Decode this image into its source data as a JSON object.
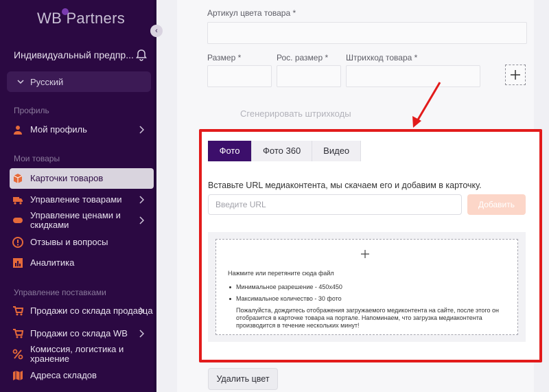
{
  "app": {
    "logo_text": "WB Partners"
  },
  "sidebar": {
    "org_name": "Индивидуальный предпр...",
    "language": "Русский",
    "sections": {
      "profile": "Профиль",
      "goods": "Мои товары",
      "supply": "Управление поставками"
    },
    "items": [
      {
        "label": "Мой профиль",
        "icon": "user-icon"
      },
      {
        "label": "Карточки товаров",
        "icon": "box-icon",
        "active": true
      },
      {
        "label": "Управление товарами",
        "icon": "truck-icon"
      },
      {
        "label": "Управление ценами и скидками",
        "icon": "tag-icon"
      },
      {
        "label": "Отзывы и вопросы",
        "icon": "alert-icon"
      },
      {
        "label": "Аналитика",
        "icon": "chart-icon"
      },
      {
        "label": "Продажи со склада продавца",
        "icon": "cart-icon"
      },
      {
        "label": "Продажи со склада WB",
        "icon": "cart-icon"
      },
      {
        "label": "Комиссия, логистика и хранение",
        "icon": "percent-icon"
      },
      {
        "label": "Адреса складов",
        "icon": "map-icon"
      }
    ]
  },
  "form": {
    "color_article_label": "Артикул цвета товара *",
    "size_label": "Размер *",
    "ru_size_label": "Рос. размер *",
    "barcode_label": "Штрихкод товара *",
    "generate_barcodes": "Сгенерировать штрихкоды",
    "delete_color": "Удалить цвет"
  },
  "media": {
    "tabs": [
      "Фото",
      "Фото 360",
      "Видео"
    ],
    "active_tab": "Фото",
    "hint": "Вставьте URL медиаконтента, мы скачаем его и добавим в карточку.",
    "url_placeholder": "Введите URL",
    "add_button": "Добавить",
    "drop_title": "Нажмите или перетяните сюда файл",
    "requirements": [
      "Минимальное разрешение - 450x450",
      "Максимальное количество - 30 фото"
    ],
    "note": "Пожалуйста, дождитесь отображения загружаемого медиконтента на сайте, после этого он отобразится в карточке товара на портале. Напоминаем, что загрузка медиаконтента производится в течение нескольких минут!"
  },
  "colors": {
    "sidebar": "#2b0942",
    "accent": "#3c0f6b",
    "highlight": "#e21b1b",
    "add_button": "#fcd6c8"
  }
}
